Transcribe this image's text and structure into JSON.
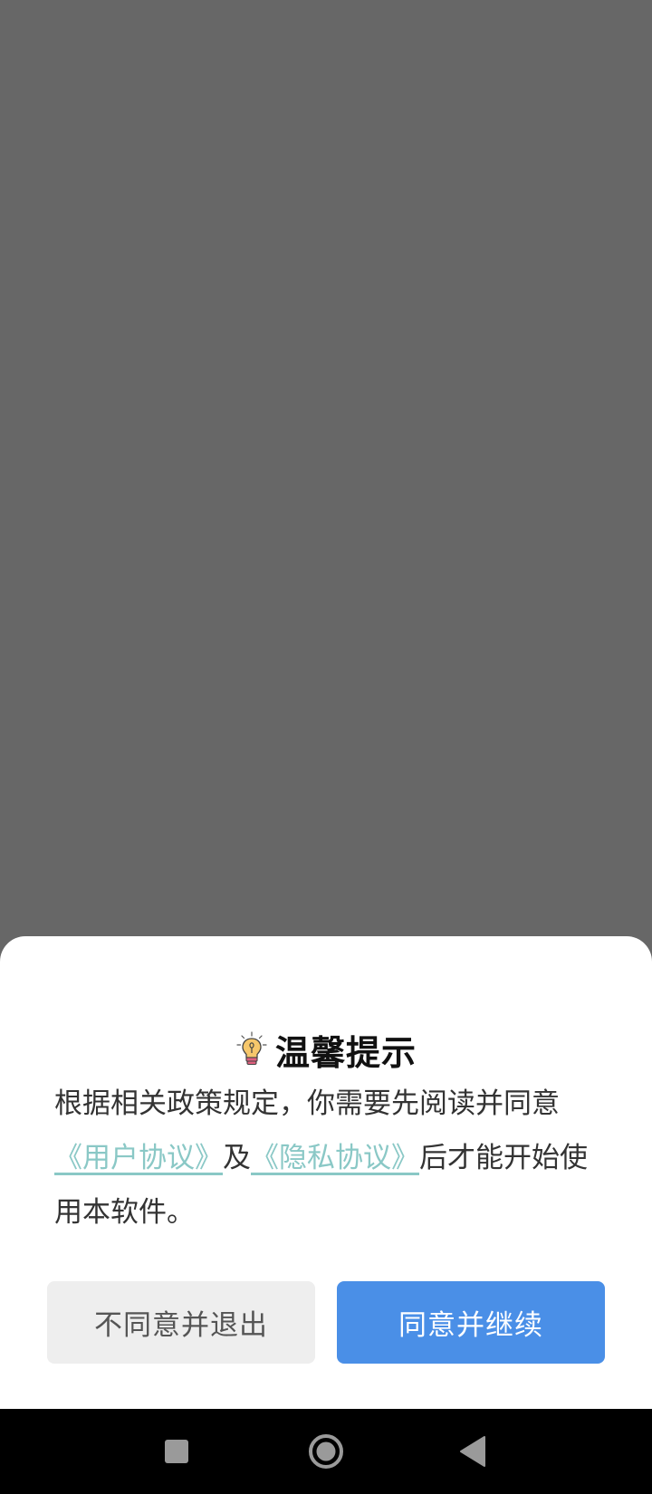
{
  "dialog": {
    "title": "温馨提示",
    "title_icon": "lightbulb-icon",
    "message_part1": "根据相关政策规定，你需要先阅读并同意",
    "user_agreement_link": "《用户协议》",
    "message_and": "及",
    "privacy_agreement_link": "《隐私协议》",
    "message_part2": "后才能开始使用本软件。",
    "decline_label": "不同意并退出",
    "accept_label": "同意并继续"
  },
  "navbar": {
    "recent_icon": "square-recent-apps-icon",
    "home_icon": "circle-home-icon",
    "back_icon": "triangle-back-icon"
  },
  "colors": {
    "overlay": "#676767",
    "link": "#8ac8c6",
    "accent": "#4a8fe7",
    "decline_bg": "#eeeeee"
  }
}
